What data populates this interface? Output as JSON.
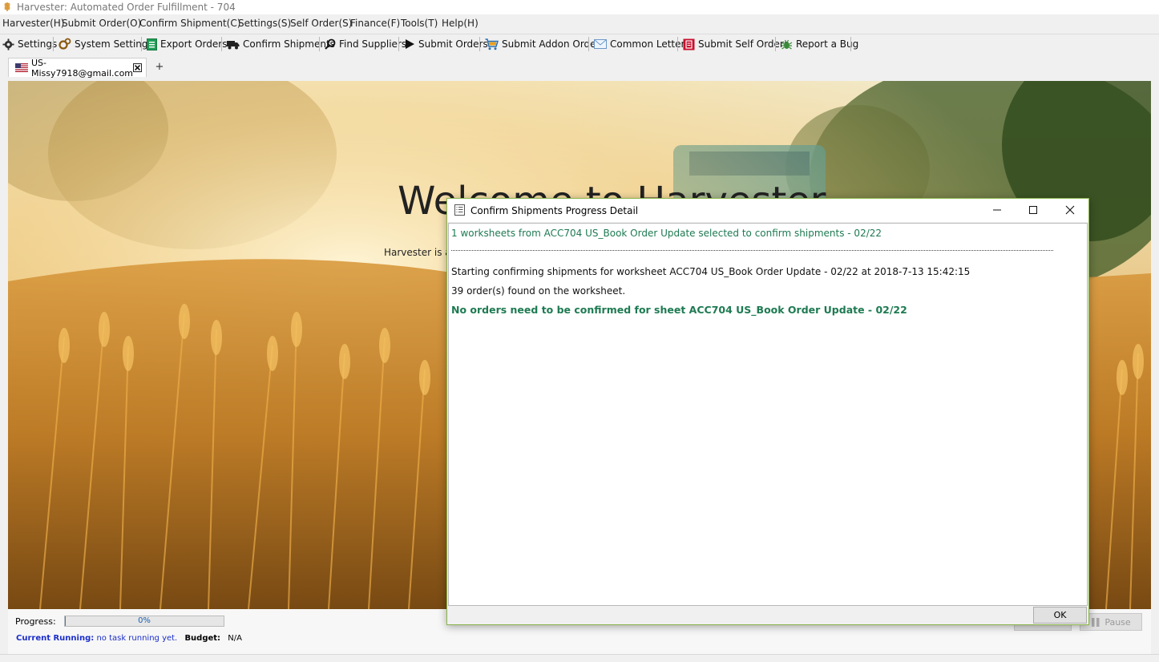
{
  "window": {
    "title": "Harvester: Automated Order Fulfillment - 704"
  },
  "menu": [
    "Harvester(H)",
    "Submit Order(O)",
    "Confirm Shipment(C)",
    "Settings(S)",
    "Self Order(S)",
    "Finance(F)",
    "Tools(T)",
    "Help(H)"
  ],
  "toolbar": {
    "settings": "Settings",
    "system_settings": "System Settings",
    "export_orders": "Export Orders",
    "confirm_shipments": "Confirm Shipments",
    "find_suppliers": "Find Suppliers",
    "submit_orders": "Submit Orders",
    "submit_addon_orders": "Submit Addon Orders",
    "common_letters": "Common Letters",
    "submit_self_orders": "Submit Self Orders",
    "report_bug": "Report a Bug"
  },
  "tabs": {
    "active_label": "US-Missy7918@gmail.com",
    "add_label": "+"
  },
  "welcome": {
    "heading": "Welcome to Harvester",
    "subtext": "Harvester is a"
  },
  "status": {
    "progress_label": "Progress:",
    "progress_value": 0,
    "progress_text": "0%",
    "current_running_label": "Current Running:",
    "current_running_value": "no task running yet.",
    "budget_label": "Budget:",
    "budget_value": "N/A",
    "pause_label": "Pause"
  },
  "dialog": {
    "title": "Confirm Shipments Progress Detail",
    "lines": {
      "selected": "1 worksheets from ACC704 US_Book Order Update  selected to confirm shipments - 02/22",
      "starting": "Starting confirming shipments for worksheet ACC704 US_Book Order Update  - 02/22 at 2018-7-13 15:42:15",
      "found": "39  order(s) found on the worksheet.",
      "none": "No  orders need to be confirmed for sheet ACC704 US_Book Order Update  - 02/22"
    },
    "ok_label": "OK"
  },
  "colors": {
    "log_green": "#1e7a52",
    "running_blue": "#1b2ec9",
    "dialog_border": "#8ab54a"
  }
}
